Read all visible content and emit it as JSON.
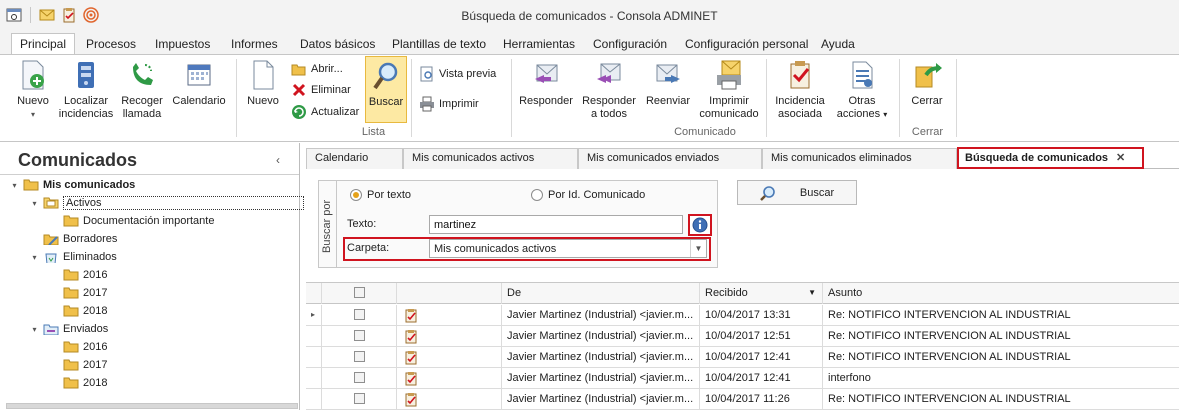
{
  "window": {
    "title": "Búsqueda de comunicados - Consola ADMINET"
  },
  "quick_access": [
    "app-icon",
    "mail-icon",
    "clipboard-icon",
    "rss-icon"
  ],
  "ribbon_tabs": [
    "Principal",
    "Procesos",
    "Impuestos",
    "Informes",
    "Datos básicos",
    "Plantillas de texto",
    "Herramientas",
    "Configuración",
    "Configuración personal",
    "Ayuda"
  ],
  "active_ribbon_tab": "Principal",
  "ribbon": {
    "nuevo1": "Nuevo",
    "localizar": "Localizar",
    "localizar2": "incidencias",
    "recoger": "Recoger",
    "recoger2": "llamada",
    "calendario": "Calendario",
    "nuevo2": "Nuevo",
    "abrir": "Abrir...",
    "eliminar": "Eliminar",
    "actualizar": "Actualizar",
    "buscar": "Buscar",
    "vista_previa": "Vista previa",
    "imprimir": "Imprimir",
    "responder": "Responder",
    "responder_todos": "Responder",
    "responder_todos2": "a todos",
    "reenviar": "Reenviar",
    "imprimir_com": "Imprimir",
    "imprimir_com2": "comunicado",
    "incidencia": "Incidencia",
    "incidencia2": "asociada",
    "otras": "Otras",
    "otras2": "acciones",
    "cerrar": "Cerrar",
    "group_lista": "Lista",
    "group_comunicado": "Comunicado",
    "group_cerrar": "Cerrar"
  },
  "left_panel": {
    "title": "Comunicados",
    "collapse_icon": "‹",
    "tree": {
      "root": "Mis comunicados",
      "activos": "Activos",
      "doc_importante": "Documentación importante",
      "borradores": "Borradores",
      "eliminados": "Eliminados",
      "e2016": "2016",
      "e2017": "2017",
      "e2018": "2018",
      "enviados": "Enviados",
      "v2016": "2016",
      "v2017": "2017",
      "v2018": "2018"
    }
  },
  "doc_tabs": [
    "Calendario",
    "Mis comunicados activos",
    "Mis comunicados enviados",
    "Mis comunicados eliminados",
    "Búsqueda de comunicados"
  ],
  "active_doc_tab": "Búsqueda de comunicados",
  "search": {
    "group_label": "Buscar por",
    "radio_texto": "Por texto",
    "radio_id": "Por Id. Comunicado",
    "selected_radio": "Por texto",
    "texto_label": "Texto:",
    "texto_value": "martinez",
    "carpeta_label": "Carpeta:",
    "carpeta_value": "Mis comunicados activos",
    "buscar_button": "Buscar"
  },
  "grid": {
    "columns": [
      "",
      "",
      "De",
      "Recibido",
      "Asunto"
    ],
    "rows": [
      {
        "de": "Javier Martinez (Industrial) <javier.m...",
        "recibido": "10/04/2017 13:31",
        "asunto": "Re: NOTIFICO INTERVENCION AL INDUSTRIAL"
      },
      {
        "de": "Javier Martinez (Industrial) <javier.m...",
        "recibido": "10/04/2017 12:51",
        "asunto": "Re: NOTIFICO INTERVENCION AL INDUSTRIAL"
      },
      {
        "de": "Javier Martinez (Industrial) <javier.m...",
        "recibido": "10/04/2017 12:41",
        "asunto": "Re: NOTIFICO INTERVENCION AL INDUSTRIAL"
      },
      {
        "de": "Javier Martinez (Industrial) <javier.m...",
        "recibido": "10/04/2017 12:41",
        "asunto": "interfono"
      },
      {
        "de": "Javier Martinez (Industrial) <javier.m...",
        "recibido": "10/04/2017 11:26",
        "asunto": "Re: NOTIFICO INTERVENCION AL INDUSTRIAL"
      }
    ]
  }
}
